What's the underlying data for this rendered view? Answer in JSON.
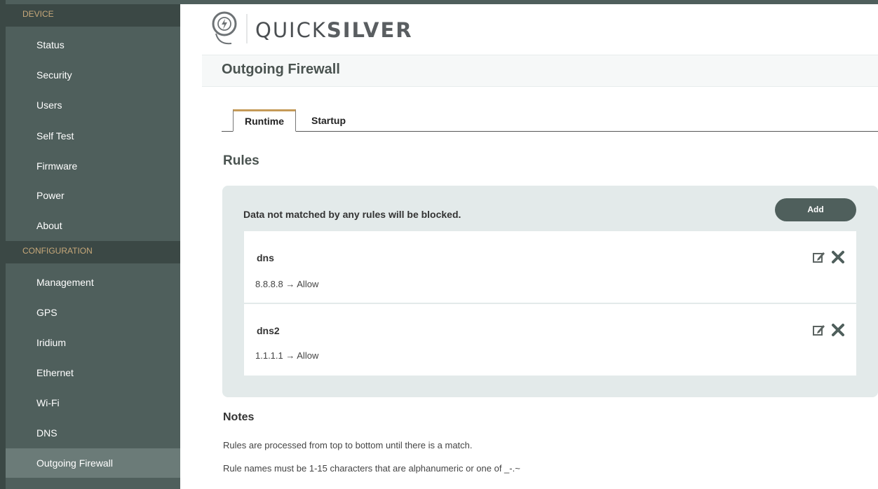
{
  "sidebar": {
    "device_header": "DEVICE",
    "device_items": [
      {
        "label": "Status"
      },
      {
        "label": "Security"
      },
      {
        "label": "Users"
      },
      {
        "label": "Self Test"
      },
      {
        "label": "Firmware"
      },
      {
        "label": "Power"
      },
      {
        "label": "About"
      }
    ],
    "config_header": "CONFIGURATION",
    "config_items": [
      {
        "label": "Management"
      },
      {
        "label": "GPS"
      },
      {
        "label": "Iridium"
      },
      {
        "label": "Ethernet"
      },
      {
        "label": "Wi-Fi"
      },
      {
        "label": "DNS"
      },
      {
        "label": "Outgoing Firewall"
      }
    ],
    "active_item": "Outgoing Firewall"
  },
  "header": {
    "brand_thin": "QUICK",
    "brand_bold": "SILVER"
  },
  "page": {
    "title": "Outgoing Firewall",
    "tabs": [
      {
        "label": "Runtime",
        "active": true
      },
      {
        "label": "Startup",
        "active": false
      }
    ],
    "rules_title": "Rules",
    "panel_message": "Data not matched by any rules will be blocked.",
    "add_label": "Add",
    "rules": [
      {
        "name": "dns",
        "detail": "8.8.8.8 → Allow"
      },
      {
        "name": "dns2",
        "detail": "1.1.1.1 → Allow"
      }
    ],
    "notes_title": "Notes",
    "notes": [
      "Rules are processed from top to bottom until there is a match.",
      "Rule names must be 1-15 characters that are alphanumeric or one of _-.~"
    ]
  },
  "colors": {
    "sidebar_bg": "#4f5f5c",
    "section_header_text": "#c7a87a",
    "accent": "#c59a58",
    "panel_bg": "#e3eaea"
  },
  "icons": [
    "lightning-logo-icon",
    "edit-icon",
    "close-icon"
  ]
}
